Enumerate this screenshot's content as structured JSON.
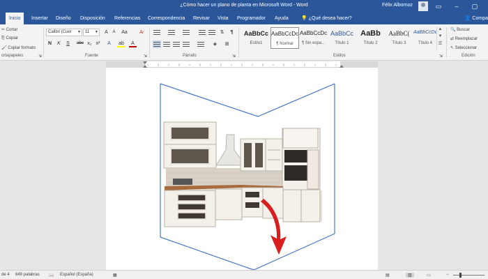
{
  "window": {
    "title": "¿Cómo hacer un plano de planta en Microsoft Word  -  Word",
    "user": "Félix Albornoz",
    "ribbon_display_icon": "ribbon-display-icon",
    "minimize_icon": "minimize-icon",
    "maximize_icon": "maximize-icon"
  },
  "tabs": [
    {
      "label": "Inicio",
      "active": true
    },
    {
      "label": "Insertar"
    },
    {
      "label": "Diseño"
    },
    {
      "label": "Disposición"
    },
    {
      "label": "Referencias"
    },
    {
      "label": "Correspondencia"
    },
    {
      "label": "Revisar"
    },
    {
      "label": "Vista"
    },
    {
      "label": "Programador"
    },
    {
      "label": "Ayuda"
    },
    {
      "label": "¿Qué desea hacer?",
      "icon": "lightbulb-icon"
    }
  ],
  "share_label": "Compa",
  "clipboard": {
    "cut": "Cortar",
    "copy": "Copiar",
    "format_painter": "Copiar formato",
    "group_label": "ortapapeles"
  },
  "font": {
    "family": "Calibri (Cuer",
    "size": "11",
    "grow": "A",
    "shrink": "A",
    "case": "Aa",
    "bold": "N",
    "italic": "K",
    "underline": "S",
    "strike": "abc",
    "subscript": "x₂",
    "superscript": "x²",
    "effects": "A",
    "highlight": "ab",
    "color": "A",
    "group_label": "Fuente"
  },
  "paragraph": {
    "group_label": "Párrafo",
    "pilcrow": "¶"
  },
  "styles": {
    "group_label": "Estilos",
    "items": [
      {
        "sample": "AaBbCc",
        "name": "Estilo1"
      },
      {
        "sample": "AaBbCcDc",
        "name": "¶ Normal",
        "selected": true
      },
      {
        "sample": "AaBbCcDc",
        "name": "¶ Sin espa..."
      },
      {
        "sample": "AaBbCc",
        "name": "Título 1"
      },
      {
        "sample": "AaBb",
        "name": "Título 2"
      },
      {
        "sample": "AaBbC(",
        "name": "Título 3"
      },
      {
        "sample": "AaBbCcDc",
        "name": "Título 4"
      }
    ]
  },
  "editing": {
    "find": "Buscar",
    "replace": "Reemplazar",
    "select": "Seleccionar",
    "group_label": "Edición"
  },
  "status": {
    "page": "de 4",
    "words": "649 palabras",
    "language": "Español (España)"
  },
  "colors": {
    "accent": "#2b579a",
    "highlight": "#ffff00",
    "font_color": "#c00000",
    "arrow": "#d81e1e",
    "plan_lines": "#4a78c2"
  }
}
